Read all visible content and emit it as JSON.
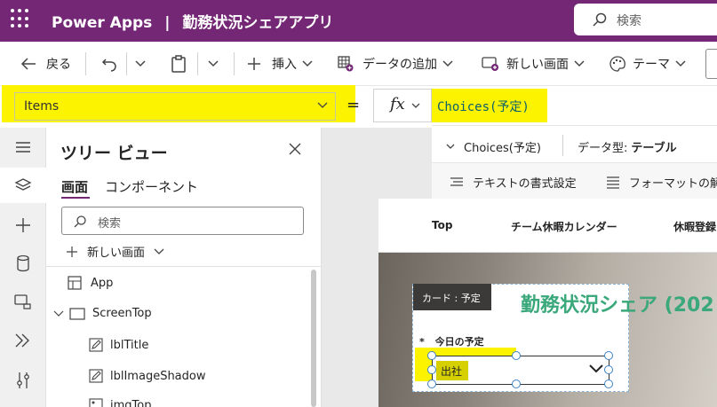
{
  "titlebar": {
    "app_name": "Power Apps",
    "separator": "|",
    "app_title": "勤務状況シェアアプリ",
    "search_placeholder": "検索",
    "bg_color": "#742774"
  },
  "commandbar": {
    "back": "戻る",
    "insert": "挿入",
    "add_data": "データの追加",
    "new_screen": "新しい画面",
    "theme": "テーマ"
  },
  "formulabar": {
    "property": "Items",
    "equals": "=",
    "fx": "fx",
    "formula": "Choices(予定)",
    "highlight_color": "#fbf300"
  },
  "context": {
    "choices_label": "Choices(予定)",
    "datatype_label": "データ型:",
    "datatype_value": "テーブル",
    "text_format": "テキストの書式設定",
    "remove_format": "フォーマットの解除"
  },
  "tree": {
    "title": "ツリー ビュー",
    "tabs": [
      "画面",
      "コンポーネント"
    ],
    "search_placeholder": "検索",
    "new_screen": "新しい画面",
    "nodes": [
      "App",
      "ScreenTop",
      "lblTitle",
      "lblImageShadow",
      "imgTop"
    ]
  },
  "canvas": {
    "nav": [
      "Top",
      "チーム休暇カレンダー",
      "休暇登録"
    ],
    "tooltip": "カード : 予定",
    "heading": "勤務状況シェア (202",
    "field_required": "*",
    "field_label": "今日の予定",
    "selected_chip": "出社",
    "heading_color": "#3aa87a"
  }
}
